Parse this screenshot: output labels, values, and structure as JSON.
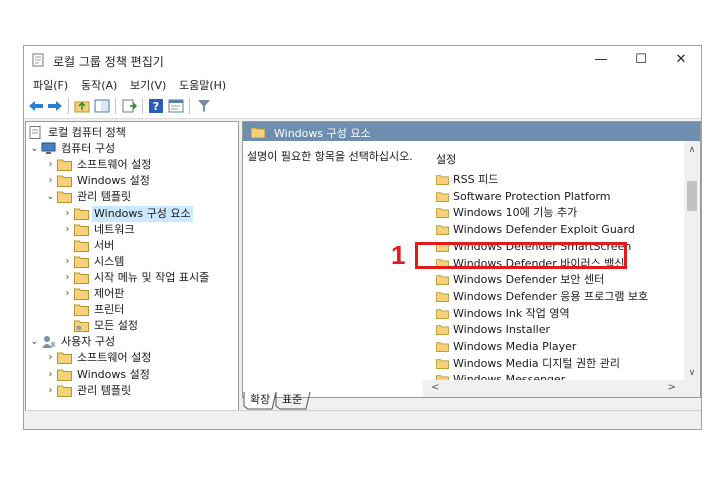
{
  "window": {
    "title": "로컬 그룹 정책 편집기",
    "controls": {
      "minimize": "—",
      "maximize": "☐",
      "close": "✕"
    }
  },
  "menu": [
    "파일(F)",
    "동작(A)",
    "보기(V)",
    "도움말(H)"
  ],
  "toolbar": {
    "icons": [
      "back-icon",
      "forward-icon",
      "up-folder-icon",
      "show-hide-tree-icon",
      "export-list-icon",
      "help-icon",
      "properties-icon",
      "filter-icon"
    ]
  },
  "tree": [
    {
      "label": "로컬 컴퓨터 정책",
      "icon": "policy-doc-icon",
      "expand": ""
    },
    {
      "label": "컴퓨터 구성",
      "icon": "computer-icon",
      "expand": "expanded"
    },
    {
      "label": "소프트웨어 설정",
      "icon": "folder-icon",
      "expand": "collapsed"
    },
    {
      "label": "Windows 설정",
      "icon": "folder-icon",
      "expand": "collapsed"
    },
    {
      "label": "관리 템플릿",
      "icon": "folder-icon",
      "expand": "expanded"
    },
    {
      "label": "Windows 구성 요소",
      "icon": "folder-icon",
      "expand": "collapsed",
      "selected": true
    },
    {
      "label": "네트워크",
      "icon": "folder-icon",
      "expand": "collapsed"
    },
    {
      "label": "서버",
      "icon": "folder-icon",
      "expand": ""
    },
    {
      "label": "시스템",
      "icon": "folder-icon",
      "expand": "collapsed"
    },
    {
      "label": "시작 메뉴 및 작업 표시줄",
      "icon": "folder-icon",
      "expand": "collapsed"
    },
    {
      "label": "제어판",
      "icon": "folder-icon",
      "expand": "collapsed"
    },
    {
      "label": "프린터",
      "icon": "folder-icon",
      "expand": ""
    },
    {
      "label": "모든 설정",
      "icon": "settings-folder-icon",
      "expand": ""
    },
    {
      "label": "사용자 구성",
      "icon": "user-icon",
      "expand": "expanded"
    },
    {
      "label": "소프트웨어 설정",
      "icon": "folder-icon",
      "expand": "collapsed"
    },
    {
      "label": "Windows 설정",
      "icon": "folder-icon",
      "expand": "collapsed"
    },
    {
      "label": "관리 템플릿",
      "icon": "folder-icon",
      "expand": "collapsed"
    }
  ],
  "right_pane": {
    "header": "Windows 구성 요소",
    "description": "설명이 필요한 항목을 선택하십시오.",
    "column_header": "설정",
    "items": [
      "RSS 피드",
      "Software Protection Platform",
      "Windows 10에 기능 추가",
      "Windows Defender Exploit Guard",
      "Windows Defender SmartScreen",
      "Windows Defender 바이러스 백신",
      "Windows Defender 보안 센터",
      "Windows Defender 응용 프로그램 보호",
      "Windows Ink 작업 영역",
      "Windows Installer",
      "Windows Media Player",
      "Windows Media 디지털 권한 관리",
      "Windows Messenger"
    ]
  },
  "tabs": [
    "확장",
    "표준"
  ],
  "annotation": {
    "number": "1",
    "color": "#e21a1a"
  },
  "colors": {
    "header_bg": "#6e8daf",
    "selection": "#cce8ff",
    "folder": "#f5d27a"
  }
}
